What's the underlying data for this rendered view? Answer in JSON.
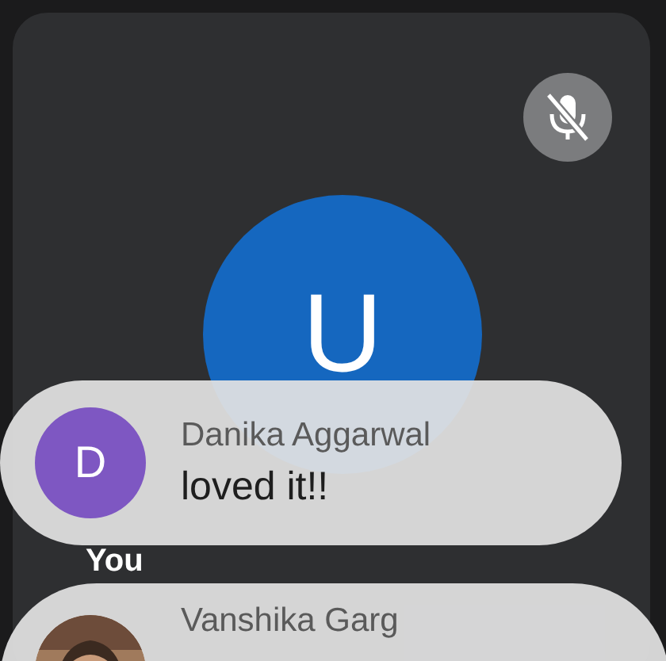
{
  "tile": {
    "mic_muted": true,
    "avatar_letter": "U",
    "label": "You"
  },
  "messages": [
    {
      "sender": "Danika Aggarwal",
      "kind": "letter",
      "avatar_letter": "D",
      "color": "#7e57c2",
      "text": "loved it!!"
    },
    {
      "sender": "Vanshika Garg",
      "kind": "picture"
    }
  ]
}
